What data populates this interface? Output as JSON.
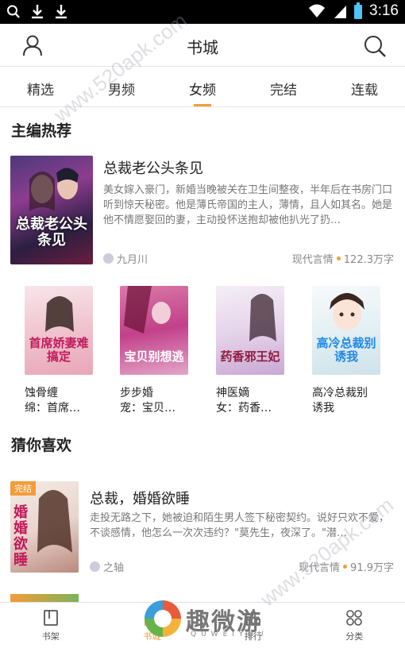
{
  "status_bar": {
    "time": "3:16"
  },
  "header": {
    "title": "书城"
  },
  "tabs": [
    {
      "label": "精选"
    },
    {
      "label": "男频"
    },
    {
      "label": "女频",
      "active": true
    },
    {
      "label": "完结"
    },
    {
      "label": "连载"
    }
  ],
  "editor_picks": {
    "title": "主编热荐",
    "featured": {
      "cover_text": "总裁老公头条见",
      "title": "总裁老公头条见",
      "description": "美女嫁入豪门，新婚当晚被关在卫生间整夜，半年后在书房门口听到惊天秘密。他是薄氏帝国的主人，薄情，且人如其名。她是他不情愿娶回的妻，主动投怀送抱却被他扒光了扔…",
      "author": "九月川",
      "category": "现代言情",
      "word_count": "122.3万字"
    },
    "grid": [
      {
        "cover_text": "首席娇妻难搞定",
        "name": "蚀骨缠",
        "sub": "绵：首席…"
      },
      {
        "cover_text": "宝贝别想逃",
        "name": "步步婚",
        "sub": "宠：宝贝…"
      },
      {
        "cover_text": "药香邪王妃",
        "name": "神医嫡",
        "sub": "女：药香…"
      },
      {
        "cover_text": "高冷总裁别诱我",
        "name": "高冷总裁别",
        "sub": "诱我"
      }
    ]
  },
  "guess": {
    "title": "猜你喜欢",
    "items": [
      {
        "badge": "完结",
        "cover_text": "婚婚欲睡",
        "title": "总裁，婚婚欲睡",
        "description": "走投无路之下，她被迫和陌生男人签下秘密契约。说好只欢不爱，不谈感情，他怎么一次次违约？\"莫先生，夜深了。\"潜…",
        "author": "之轴",
        "category": "现代言情",
        "word_count": "91.9万字"
      }
    ]
  },
  "bottom_nav": [
    {
      "label": "书架"
    },
    {
      "label": "书城",
      "active": true
    },
    {
      "label": "排行"
    },
    {
      "label": "分类"
    }
  ],
  "watermark": {
    "logo_text": "趣微游",
    "logo_sub": "QUWEIYOU",
    "site": "www.520apk.com"
  },
  "colors": {
    "accent": "#f39c3a",
    "text": "#222222",
    "muted": "#777777"
  }
}
